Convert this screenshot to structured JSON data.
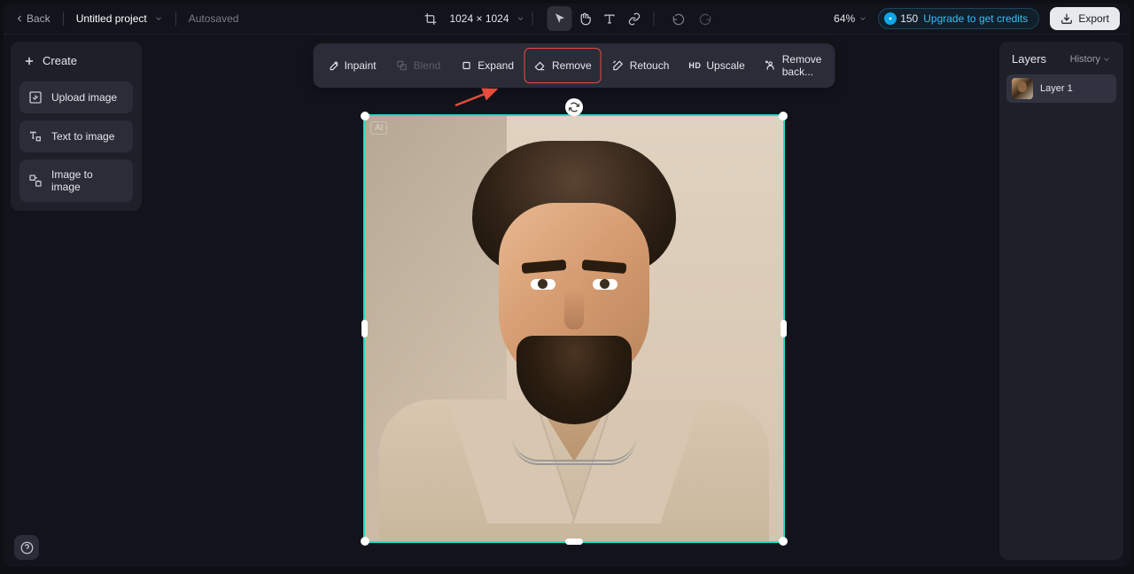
{
  "topbar": {
    "back": "Back",
    "project_title": "Untitled project",
    "autosaved": "Autosaved",
    "dimensions": "1024 × 1024",
    "zoom": "64%",
    "credits": "150",
    "upgrade_text": "Upgrade to get credits",
    "export": "Export"
  },
  "left_panel": {
    "header": "Create",
    "options": [
      {
        "label": "Upload image",
        "icon": "upload-icon"
      },
      {
        "label": "Text to image",
        "icon": "text-to-image-icon"
      },
      {
        "label": "Image to image",
        "icon": "image-to-image-icon"
      }
    ]
  },
  "action_bar": {
    "items": [
      {
        "label": "Inpaint",
        "icon": "inpaint-icon",
        "disabled": false,
        "highlighted": false
      },
      {
        "label": "Blend",
        "icon": "blend-icon",
        "disabled": true,
        "highlighted": false
      },
      {
        "label": "Expand",
        "icon": "expand-icon",
        "disabled": false,
        "highlighted": false
      },
      {
        "label": "Remove",
        "icon": "eraser-icon",
        "disabled": false,
        "highlighted": true
      },
      {
        "label": "Retouch",
        "icon": "retouch-icon",
        "disabled": false,
        "highlighted": false
      },
      {
        "label": "Upscale",
        "icon": "hd-icon",
        "disabled": false,
        "highlighted": false
      },
      {
        "label": "Remove back...",
        "icon": "remove-bg-icon",
        "disabled": false,
        "highlighted": false
      }
    ]
  },
  "canvas": {
    "ai_badge": "AI",
    "selection_border_color": "#1edec6",
    "highlight_color": "#e74c3c"
  },
  "right_panel": {
    "title": "Layers",
    "history": "History",
    "layers": [
      {
        "label": "Layer 1"
      }
    ]
  }
}
